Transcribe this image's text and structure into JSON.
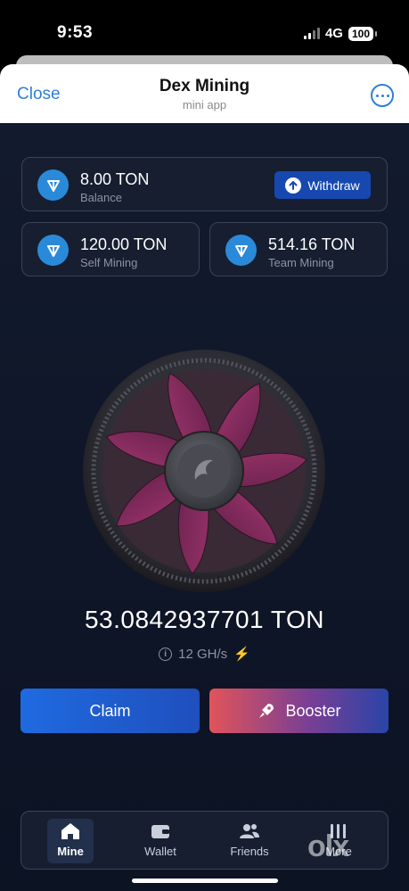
{
  "status_bar": {
    "time": "9:53",
    "network": "4G",
    "battery": "100"
  },
  "header": {
    "close_label": "Close",
    "title": "Dex Mining",
    "subtitle": "mini app",
    "menu_icon": "more-dots-icon"
  },
  "balance_card": {
    "value": "8.00 TON",
    "label": "Balance",
    "withdraw_label": "Withdraw"
  },
  "self_mining_card": {
    "value": "120.00 TON",
    "label": "Self Mining"
  },
  "team_mining_card": {
    "value": "514.16 TON",
    "label": "Team Mining"
  },
  "mined_amount": "53.0842937701 TON",
  "hashrate": "12 GH/s",
  "actions": {
    "claim_label": "Claim",
    "booster_label": "Booster"
  },
  "nav": [
    {
      "label": "Mine",
      "icon": "home-icon",
      "active": true
    },
    {
      "label": "Wallet",
      "icon": "wallet-icon",
      "active": false
    },
    {
      "label": "Friends",
      "icon": "friends-icon",
      "active": false
    },
    {
      "label": "More",
      "icon": "more-icon",
      "active": false
    }
  ],
  "watermark": "olx",
  "colors": {
    "accent_blue": "#2f7fd8",
    "ton_blue": "#2a8ad9",
    "background": "#0f1628",
    "bolt": "#f2c01d"
  }
}
